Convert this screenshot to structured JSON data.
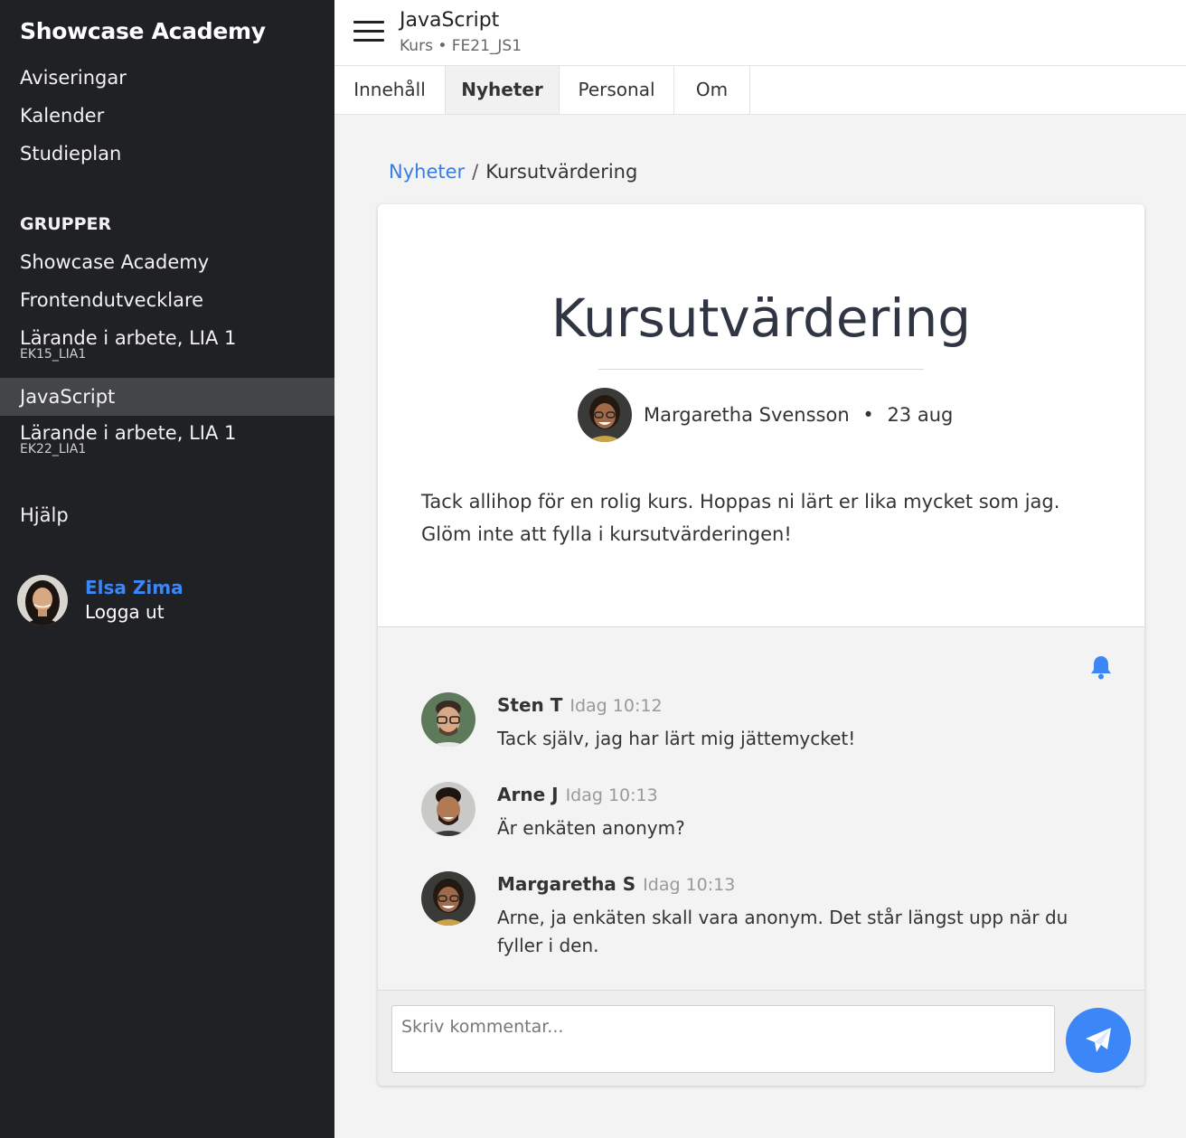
{
  "sidebar": {
    "brand": "Showcase Academy",
    "nav": [
      "Aviseringar",
      "Kalender",
      "Studieplan"
    ],
    "groups_heading": "GRUPPER",
    "groups": [
      {
        "label": "Showcase Academy",
        "sub": ""
      },
      {
        "label": "Frontendutvecklare",
        "sub": ""
      },
      {
        "label": "Lärande i arbete, LIA 1",
        "sub": "EK15_LIA1"
      },
      {
        "label": "JavaScript",
        "sub": ""
      },
      {
        "label": "Lärande i arbete, LIA 1",
        "sub": "EK22_LIA1"
      }
    ],
    "help": "Hjälp",
    "user": {
      "name": "Elsa Zima",
      "logout": "Logga ut"
    }
  },
  "header": {
    "title": "JavaScript",
    "subtitle": "Kurs • FE21_JS1"
  },
  "tabs": [
    "Innehåll",
    "Nyheter",
    "Personal",
    "Om"
  ],
  "breadcrumb": {
    "parent": "Nyheter",
    "separator": "/",
    "current": "Kursutvärdering"
  },
  "post": {
    "title": "Kursutvärdering",
    "author": "Margaretha Svensson",
    "date": "23 aug",
    "dot": "•",
    "body": "Tack allihop för en rolig kurs. Hoppas ni lärt er lika mycket som jag. Glöm inte att fylla i kursutvärderingen!"
  },
  "comments": [
    {
      "name": "Sten T",
      "time": "Idag 10:12",
      "text": "Tack själv, jag har lärt mig jättemycket!"
    },
    {
      "name": "Arne J",
      "time": "Idag 10:13",
      "text": "Är enkäten anonym?"
    },
    {
      "name": "Margaretha S",
      "time": "Idag 10:13",
      "text": "Arne, ja enkäten skall vara anonym. Det står längst upp när du fyller i den."
    }
  ],
  "compose": {
    "placeholder": "Skriv kommentar..."
  },
  "colors": {
    "accent": "#3b87f7",
    "sidebar": "#202124",
    "sidebar_active": "#444548"
  },
  "icons": {
    "menu": "hamburger-icon",
    "bell": "bell-icon",
    "send": "paper-plane-icon"
  }
}
